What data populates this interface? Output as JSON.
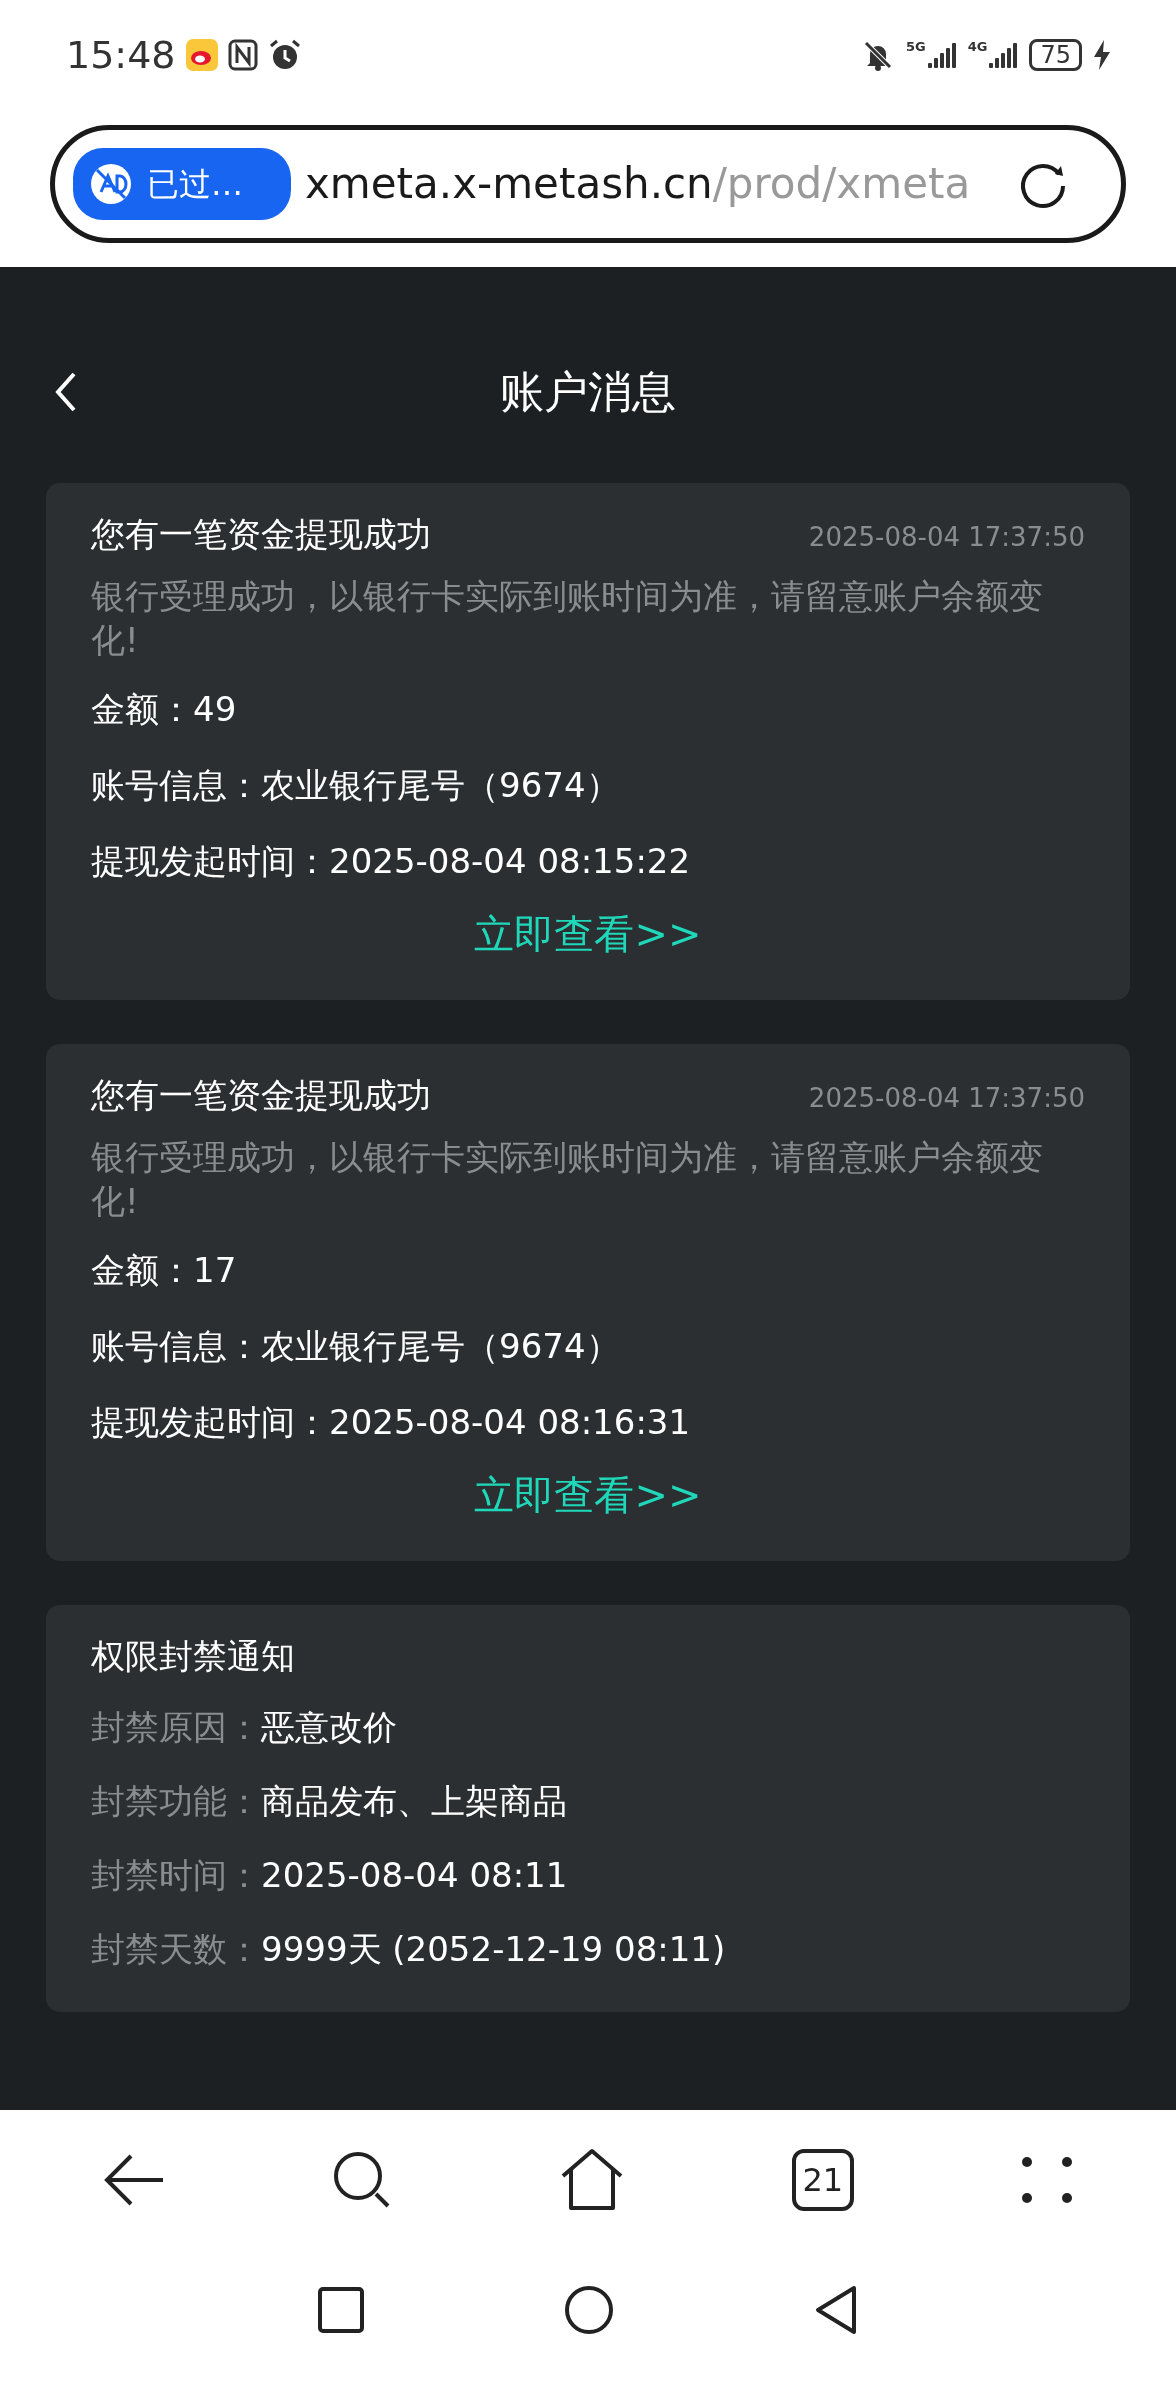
{
  "status_bar": {
    "time": "15:48",
    "networks": [
      "5G",
      "4G"
    ],
    "battery": "75"
  },
  "address_bar": {
    "ad_badge": "已过…",
    "url_host": "xmeta.x-metash.cn",
    "url_path": "/prod/xmeta"
  },
  "header": {
    "title": "账户消息"
  },
  "messages": [
    {
      "kind": "withdrawal",
      "title": "您有一笔资金提现成功",
      "time": "2025-08-04 17:37:50",
      "description": "银行受理成功，以银行卡实际到账时间为准，请留意账户余额变化!",
      "fields": [
        {
          "label": "金额：",
          "value": "49"
        },
        {
          "label": "账号信息：",
          "value": "农业银行尾号（9674）"
        },
        {
          "label": "提现发起时间：",
          "value": "2025-08-04 08:15:22"
        }
      ],
      "link": "立即查看>>"
    },
    {
      "kind": "withdrawal",
      "title": "您有一笔资金提现成功",
      "time": "2025-08-04 17:37:50",
      "description": "银行受理成功，以银行卡实际到账时间为准，请留意账户余额变化!",
      "fields": [
        {
          "label": "金额：",
          "value": "17"
        },
        {
          "label": "账号信息：",
          "value": "农业银行尾号（9674）"
        },
        {
          "label": "提现发起时间：",
          "value": "2025-08-04 08:16:31"
        }
      ],
      "link": "立即查看>>"
    },
    {
      "kind": "ban",
      "title": "权限封禁通知",
      "fields": [
        {
          "label": "封禁原因：",
          "value": "恶意改价"
        },
        {
          "label": "封禁功能：",
          "value": "商品发布、上架商品"
        },
        {
          "label": "封禁时间：",
          "value": "2025-08-04 08:11"
        },
        {
          "label": "封禁天数：",
          "value": "9999天 (2052-12-19 08:11)"
        }
      ]
    }
  ],
  "bottom_nav": {
    "tab_count": "21"
  }
}
